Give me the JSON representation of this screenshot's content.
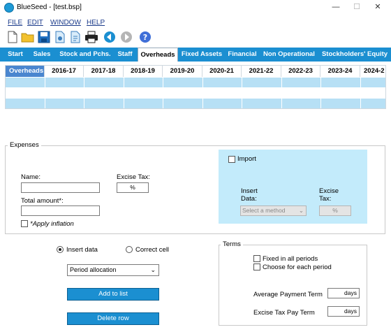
{
  "window": {
    "app_name": "BlueSeed",
    "file_name": "[test.bsp]",
    "title_separator": " - ",
    "minimize_glyph": "—",
    "maximize_glyph": "☐",
    "close_glyph": "✕"
  },
  "menu": [
    "FILE",
    "EDIT",
    "WINDOW",
    "HELP"
  ],
  "toolbar": [
    "new-file-icon",
    "open-folder-icon",
    "save-icon",
    "save-copy-icon",
    "export-icon",
    "print-icon",
    "back-icon",
    "forward-icon",
    "help-icon"
  ],
  "tabs": [
    "Start",
    "Sales",
    "Stock and Pchs.",
    "Staff",
    "Overheads",
    "Fixed Assets",
    "Financial",
    "Non Operational",
    "Stockholders' Equity"
  ],
  "active_tab": "Overheads",
  "grid": {
    "headers": [
      "Overheads",
      "2016-17",
      "2017-18",
      "2018-19",
      "2019-20",
      "2020-21",
      "2021-22",
      "2022-23",
      "2023-24",
      "2024-2"
    ],
    "row_count": 3
  },
  "expenses": {
    "group_title": "Expenses",
    "name_label": "Name:",
    "name_value": "",
    "excise_tax_label": "Excise Tax:",
    "excise_tax_unit": "%",
    "total_amount_label": "Total amount*:",
    "total_amount_value": "",
    "apply_inflation_label": "*Apply inflation",
    "import": {
      "label": "Import",
      "insert_data_label": "Insert\nData:",
      "insert_data_line1": "Insert",
      "insert_data_line2": "Data:",
      "method_placeholder": "Select a method",
      "excise_line1": "Excise",
      "excise_line2": "Tax:",
      "excise_unit": "%"
    }
  },
  "mode": {
    "insert_data_label": "Insert data",
    "correct_cell_label": "Correct cell",
    "selected": "Insert data",
    "allocation_value": "Period allocation",
    "add_button": "Add to list",
    "delete_button": "Delete row"
  },
  "terms": {
    "group_title": "Terms",
    "fixed_label": "Fixed in all periods",
    "choose_label": "Choose for each period",
    "avg_payment_label": "Average Payment Term",
    "excise_pay_label": "Excise Tax Pay Term",
    "days_unit": "days"
  },
  "colors": {
    "accent": "#1b8fd1",
    "grid_row": "#b7e0f5",
    "header_active": "#4a86cf",
    "import_panel": "#c3ebfb"
  }
}
